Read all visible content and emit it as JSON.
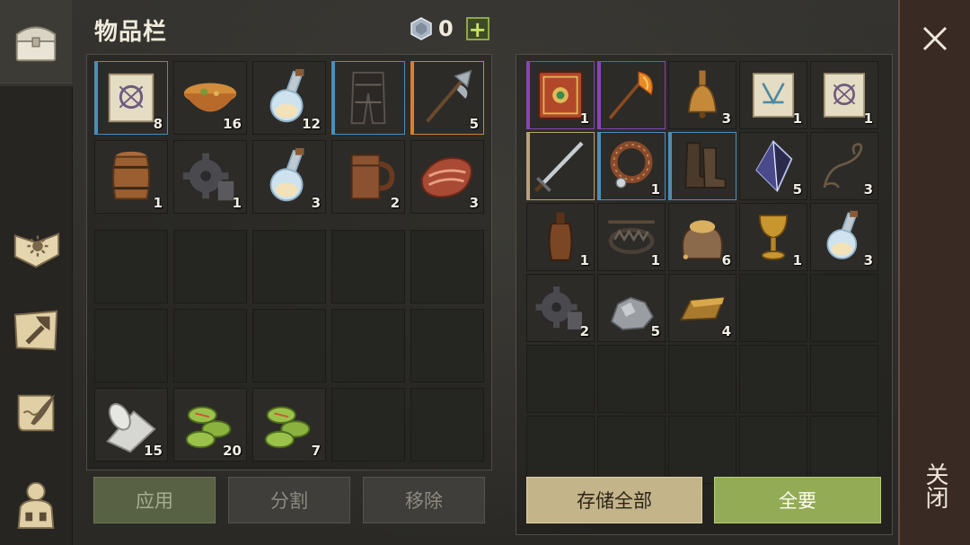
{
  "header": {
    "title": "物品栏",
    "currency_count": "0",
    "add_label": "+"
  },
  "left_nav": [
    {
      "name": "inventory-chest-icon"
    },
    {
      "name": "sun-book-icon"
    },
    {
      "name": "craft-hammer-icon"
    },
    {
      "name": "scroll-quill-icon"
    },
    {
      "name": "character-silhouette-icon"
    }
  ],
  "inventory": {
    "equipped_rows": [
      [
        {
          "icon": "treasure-map-scroll-icon",
          "qty": "8",
          "rarity": "blue"
        },
        {
          "icon": "soup-bowl-icon",
          "qty": "16",
          "rarity": ""
        },
        {
          "icon": "water-flask-icon",
          "qty": "12",
          "rarity": ""
        },
        {
          "icon": "leather-pants-icon",
          "qty": "",
          "rarity": "blue"
        },
        {
          "icon": "halberd-icon",
          "qty": "5",
          "rarity": "orange"
        }
      ],
      [
        {
          "icon": "wooden-barrel-icon",
          "qty": "1",
          "rarity": ""
        },
        {
          "icon": "iron-gear-icon",
          "qty": "1",
          "rarity": ""
        },
        {
          "icon": "water-flask-icon",
          "qty": "3",
          "rarity": ""
        },
        {
          "icon": "wooden-mug-icon",
          "qty": "2",
          "rarity": ""
        },
        {
          "icon": "raw-meat-icon",
          "qty": "3",
          "rarity": ""
        }
      ]
    ],
    "bottom_row": [
      {
        "icon": "cloth-roll-icon",
        "qty": "15"
      },
      {
        "icon": "green-coins-icon",
        "qty": "20"
      },
      {
        "icon": "green-coins-icon",
        "qty": "7"
      }
    ]
  },
  "storage": {
    "rows": [
      [
        {
          "icon": "spell-book-icon",
          "qty": "1",
          "rarity": "purple"
        },
        {
          "icon": "flame-axe-icon",
          "qty": "",
          "rarity": "purple"
        },
        {
          "icon": "bronze-bell-icon",
          "qty": "3",
          "rarity": ""
        },
        {
          "icon": "rune-scroll-icon",
          "qty": "1",
          "rarity": ""
        },
        {
          "icon": "treasure-map-scroll-icon",
          "qty": "1",
          "rarity": ""
        }
      ],
      [
        {
          "icon": "long-sword-icon",
          "qty": "",
          "rarity": "tan"
        },
        {
          "icon": "leather-collar-icon",
          "qty": "1",
          "rarity": "blue"
        },
        {
          "icon": "leather-boots-icon",
          "qty": "",
          "rarity": "blue"
        },
        {
          "icon": "dark-crystal-icon",
          "qty": "5",
          "rarity": ""
        },
        {
          "icon": "rope-icon",
          "qty": "3",
          "rarity": ""
        }
      ],
      [
        {
          "icon": "leather-bottle-icon",
          "qty": "1",
          "rarity": ""
        },
        {
          "icon": "bear-trap-icon",
          "qty": "1",
          "rarity": ""
        },
        {
          "icon": "grain-sack-icon",
          "qty": "6",
          "rarity": ""
        },
        {
          "icon": "golden-goblet-icon",
          "qty": "1",
          "rarity": ""
        },
        {
          "icon": "water-flask-icon",
          "qty": "3",
          "rarity": ""
        }
      ],
      [
        {
          "icon": "iron-gear-icon",
          "qty": "2",
          "rarity": ""
        },
        {
          "icon": "stone-ore-icon",
          "qty": "5",
          "rarity": ""
        },
        {
          "icon": "bronze-ingot-icon",
          "qty": "4",
          "rarity": ""
        }
      ]
    ]
  },
  "buttons": {
    "apply": "应用",
    "split": "分割",
    "remove": "移除",
    "store_all": "存储全部",
    "take_all": "全要"
  },
  "close": {
    "label": "关闭"
  },
  "colors": {
    "blue": "#4b8fb8",
    "purple": "#8a43b8",
    "orange": "#d2832b",
    "tan": "#b9a07a",
    "accent_green": "#93ab54"
  }
}
